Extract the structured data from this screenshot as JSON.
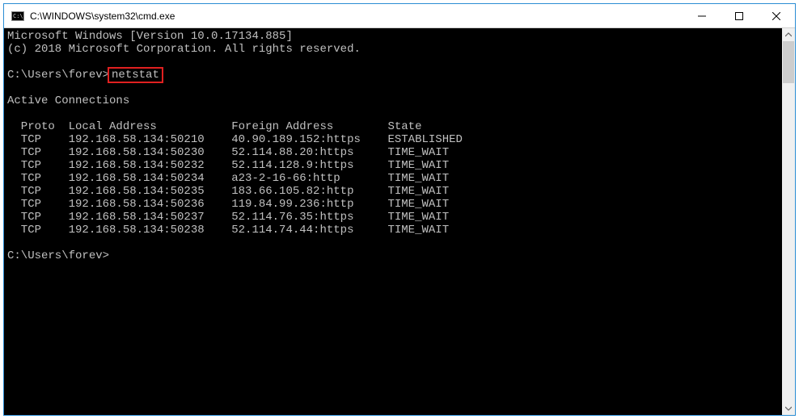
{
  "window": {
    "title": "C:\\WINDOWS\\system32\\cmd.exe"
  },
  "banner": {
    "line1": "Microsoft Windows [Version 10.0.17134.885]",
    "line2": "(c) 2018 Microsoft Corporation. All rights reserved."
  },
  "prompt1": {
    "prefix": "C:\\Users\\forev>",
    "command": "netstat"
  },
  "section_title": "Active Connections",
  "columns": {
    "proto": "Proto",
    "local": "Local Address",
    "foreign": "Foreign Address",
    "state": "State"
  },
  "connections": [
    {
      "proto": "TCP",
      "local": "192.168.58.134:50210",
      "foreign": "40.90.189.152:https",
      "state": "ESTABLISHED"
    },
    {
      "proto": "TCP",
      "local": "192.168.58.134:50230",
      "foreign": "52.114.88.20:https",
      "state": "TIME_WAIT"
    },
    {
      "proto": "TCP",
      "local": "192.168.58.134:50232",
      "foreign": "52.114.128.9:https",
      "state": "TIME_WAIT"
    },
    {
      "proto": "TCP",
      "local": "192.168.58.134:50234",
      "foreign": "a23-2-16-66:http",
      "state": "TIME_WAIT"
    },
    {
      "proto": "TCP",
      "local": "192.168.58.134:50235",
      "foreign": "183.66.105.82:http",
      "state": "TIME_WAIT"
    },
    {
      "proto": "TCP",
      "local": "192.168.58.134:50236",
      "foreign": "119.84.99.236:http",
      "state": "TIME_WAIT"
    },
    {
      "proto": "TCP",
      "local": "192.168.58.134:50237",
      "foreign": "52.114.76.35:https",
      "state": "TIME_WAIT"
    },
    {
      "proto": "TCP",
      "local": "192.168.58.134:50238",
      "foreign": "52.114.74.44:https",
      "state": "TIME_WAIT"
    }
  ],
  "prompt2": "C:\\Users\\forev>"
}
